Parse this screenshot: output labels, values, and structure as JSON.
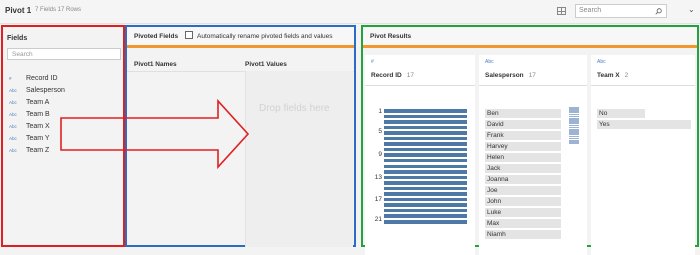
{
  "topbar": {
    "title": "Pivot 1",
    "meta": "7 Fields  17 Rows",
    "search_placeholder": "Search",
    "icons": [
      "grid-view-icon",
      "search-icon",
      "chevron-down-icon"
    ]
  },
  "fields_panel": {
    "header": "Fields",
    "search_placeholder": "Search",
    "items": [
      {
        "type": "#",
        "label": "Record ID"
      },
      {
        "type": "Abc",
        "label": "Salesperson"
      },
      {
        "type": "Abc",
        "label": "Team A"
      },
      {
        "type": "Abc",
        "label": "Team B"
      },
      {
        "type": "Abc",
        "label": "Team X"
      },
      {
        "type": "Abc",
        "label": "Team Y"
      },
      {
        "type": "Abc",
        "label": "Team Z"
      }
    ]
  },
  "pivot_panel": {
    "title": "Pivoted Fields",
    "checkbox_label": "Automatically rename pivoted fields and values",
    "checkbox_checked": false,
    "col_names": "Pivot1 Names",
    "col_values": "Pivot1 Values",
    "drop_text": "Drop fields here"
  },
  "results_panel": {
    "title": "Pivot Results",
    "cards": [
      {
        "type": "#",
        "name": "Record ID",
        "count": "17",
        "axis_labels": [
          "1",
          "5",
          "9",
          "13",
          "17",
          "21"
        ]
      },
      {
        "type": "Abc",
        "name": "Salesperson",
        "count": "17",
        "values": [
          "Ben",
          "David",
          "Frank",
          "Harvey",
          "Helen",
          "Jack",
          "Joanna",
          "Joe",
          "John",
          "Luke",
          "Max",
          "Niamh"
        ]
      },
      {
        "type": "Abc",
        "name": "Team X",
        "count": "2",
        "values": [
          "No",
          "Yes"
        ]
      }
    ]
  },
  "colors": {
    "fields_border": "#e02020",
    "pivot_border": "#2b6cc4",
    "results_border": "#22a340",
    "accent_orange": "#f2972e",
    "bar_blue": "#4e79a7",
    "arrow_red": "#e02020"
  }
}
